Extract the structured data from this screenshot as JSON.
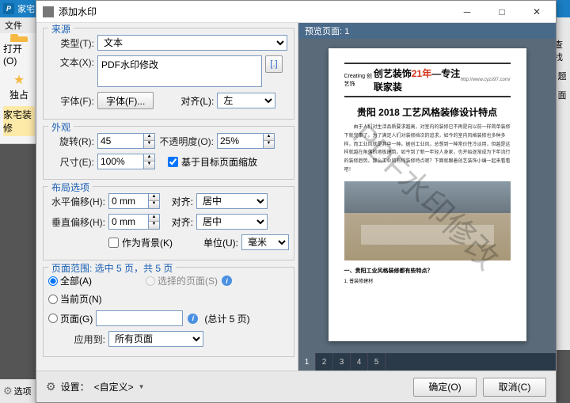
{
  "app": {
    "title": "家宅",
    "menu_file": "文件",
    "right_tabs": [
      "查找",
      "题",
      "面"
    ]
  },
  "toolbar": {
    "open": "打开(O)",
    "exclusive": "独占",
    "home": "家宅装修"
  },
  "dialog": {
    "title": "添加水印"
  },
  "source": {
    "group": "来源",
    "type_label": "类型(T):",
    "type_value": "文本",
    "text_label": "文本(X):",
    "text_value": "PDF水印修改",
    "insert_btn": "[.]",
    "font_label": "字体(F):",
    "font_btn": "字体(F)...",
    "align_label": "对齐(L):",
    "align_value": "左"
  },
  "appearance": {
    "group": "外观",
    "rotate_label": "旋转(R):",
    "rotate_value": "45",
    "opacity_label": "不透明度(O):",
    "opacity_value": "25%",
    "size_label": "尺寸(E):",
    "size_value": "100%",
    "scale_chk": "基于目标页面缩放"
  },
  "layout": {
    "group": "布局选项",
    "hoff_label": "水平偏移(H):",
    "hoff_value": "0 mm",
    "align1_label": "对齐:",
    "align1_value": "居中",
    "voff_label": "垂直偏移(H):",
    "voff_value": "0 mm",
    "align2_label": "对齐:",
    "align2_value": "居中",
    "bg_chk": "作为背景(K)",
    "unit_label": "单位(U):",
    "unit_value": "毫米"
  },
  "pagerange": {
    "group_prefix": "页面范围: ",
    "group_info": "选中 5 页，共 5 页",
    "all": "全部(A)",
    "selected": "选择的页面(S)",
    "current": "当前页(N)",
    "page": "页面(G)",
    "total": "(总计 5 页)",
    "apply_label": "应用到:",
    "apply_value": "所有页面"
  },
  "preview": {
    "header": "预览页面: 1",
    "brand_pre": "创艺装饰",
    "brand_accent": "21年",
    "brand_suf": "—专注联家装",
    "url": "http://www.cyzs97.com/",
    "logo": "Creating 创艺饰",
    "title": "贵阳 2018 工艺风格装修设计特点",
    "p1": "由于人们对生活品质要求越高，对室内的装修已不再是向以前一样简单装修下就完事了。为了满足人们对装修档次的追求，如今的室内风格装修也多种多样，而工业风就是其中一种。据创工业风，总想到一种常价性冷淡用，但越是这样就越在角落的地板建筑，如今到了新一年轻人身家，也开始逐渐成为下年流行的装修趋势。那么工业风有何装修特点呢？下面就跟着创艺装饰小编一起来看看吧！",
    "watermark": "PDF水印修改",
    "sub": "一、贵阳工业风格装修都有些特点？",
    "li": "1. 普装修建材",
    "pages": [
      "1",
      "2",
      "3",
      "4",
      "5"
    ]
  },
  "footer": {
    "settings": "设置：",
    "preset": "<自定义>",
    "ok": "确定(O)",
    "cancel": "取消(C)"
  },
  "bottom": {
    "opt": "选项"
  }
}
